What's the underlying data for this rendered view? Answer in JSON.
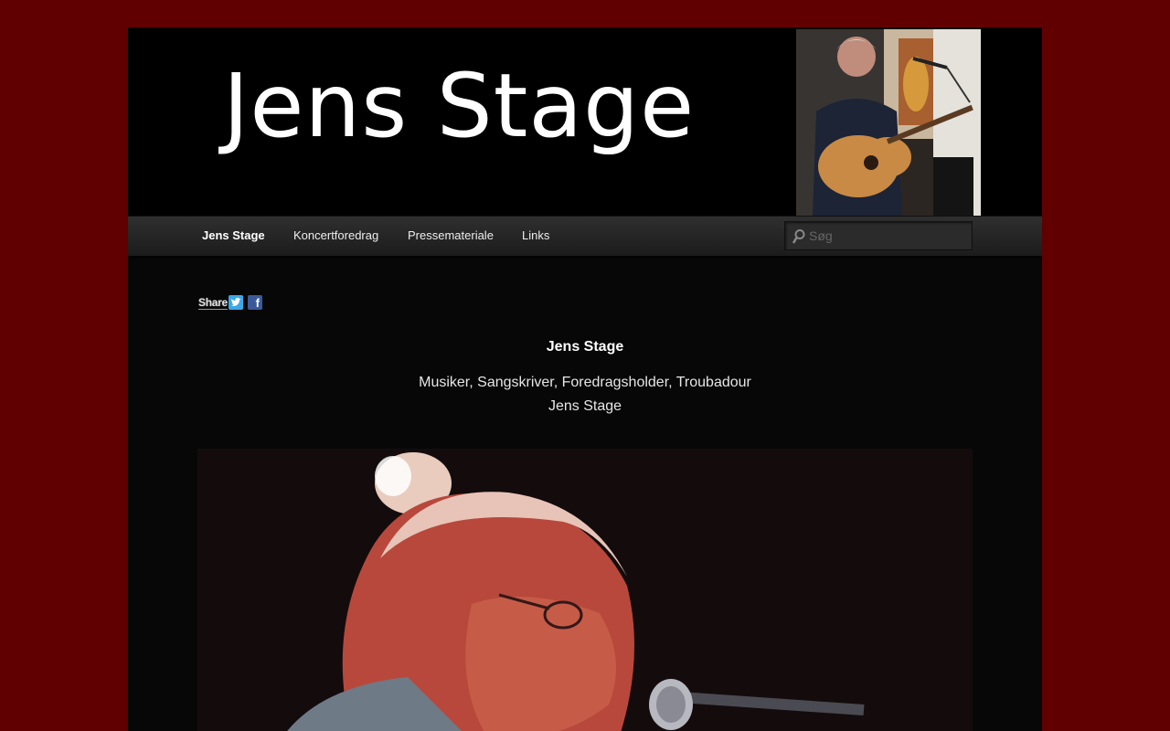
{
  "site": {
    "title": "Jens Stage",
    "header_photo": "header-portrait-with-guitar"
  },
  "nav": {
    "items": [
      {
        "label": "Jens Stage",
        "current": true
      },
      {
        "label": "Koncertforedrag",
        "current": false
      },
      {
        "label": "Pressemateriale",
        "current": false
      },
      {
        "label": "Links",
        "current": false
      }
    ]
  },
  "search": {
    "placeholder": "Søg",
    "value": "",
    "icon": "search-icon"
  },
  "share": {
    "label": "Share",
    "icons": [
      "twitter-icon",
      "facebook-icon"
    ]
  },
  "content": {
    "title": "Jens Stage",
    "subtitle_line1": "Musiker, Sangskriver, Foredragsholder, Troubadour",
    "subtitle_line2": "Jens Stage",
    "main_photo": "stage-portrait-with-microphone"
  },
  "colors": {
    "background": "#610000",
    "page": "#070707",
    "nav": "#252525",
    "text": "#ffffff"
  }
}
